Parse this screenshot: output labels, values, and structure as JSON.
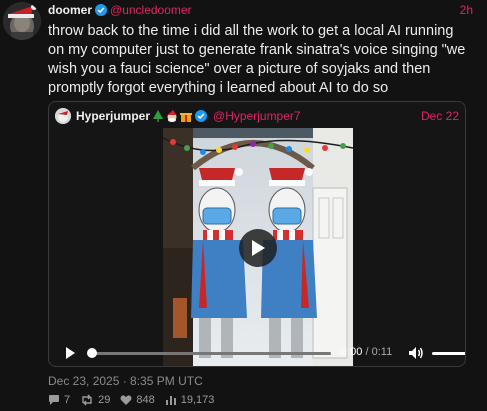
{
  "post": {
    "author": {
      "display_name": "doomer",
      "handle": "@uncledoomer",
      "time_ago": "2h"
    },
    "text": "throw back to the time i did all the work to get a local AI running on my computer just to generate frank sinatra's voice singing \"we wish you a fauci science\" over a picture of soyjaks and then promptly forgot everything i learned about AI to do so",
    "quoted": {
      "display_name": "Hyperjumper",
      "handle": "@Hyperjumper7",
      "date": "Dec 22",
      "name_emojis": [
        "christmas-tree-icon",
        "santa-icon",
        "gift-icon"
      ],
      "video": {
        "current_time": "0:00",
        "separator": " / ",
        "duration": "0:11",
        "progress": 0,
        "volume": 1.0
      }
    },
    "timestamp": "Dec 23, 2025 · 8:35 PM UTC",
    "stats": {
      "replies": "7",
      "reposts": "29",
      "likes": "848",
      "views": "19,173"
    }
  },
  "colors": {
    "accent": "#e0245e",
    "verified": "#1d9bf0",
    "background": "#121212"
  }
}
